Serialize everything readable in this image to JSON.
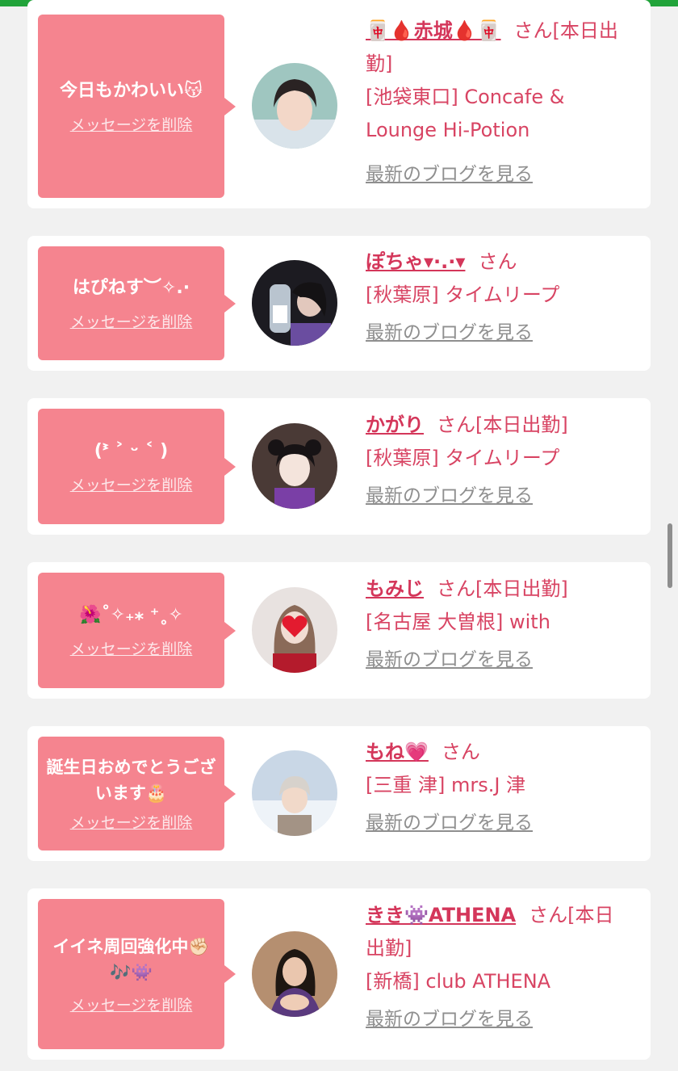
{
  "cards": [
    {
      "message": "今日もかわいい😽",
      "delete_label": "メッセージを削除",
      "name": "🀄🩸赤城🩸🀄",
      "honorific": "さん",
      "status": "[本日出勤]",
      "shop": "[池袋東口] Concafe & Lounge Hi-Potion",
      "blog_link": "最新のブログを見る"
    },
    {
      "message": "はぴねす︶✧.·",
      "delete_label": "メッセージを削除",
      "name": "ぽちゃ▾·.·▾",
      "honorific": "さん",
      "status": "",
      "shop": "[秋葉原] タイムリープ",
      "blog_link": "最新のブログを見る"
    },
    {
      "message": "(ᕑ ˃ ᵕ ˂ )",
      "delete_label": "メッセージを削除",
      "name": "かがり",
      "honorific": "さん",
      "status": "[本日出勤]",
      "shop": "[秋葉原] タイムリープ",
      "blog_link": "最新のブログを見る"
    },
    {
      "message": "🌺˚✧₊⁎ ⁺˳✧",
      "delete_label": "メッセージを削除",
      "name": "もみじ",
      "honorific": "さん",
      "status": "[本日出勤]",
      "shop": "[名古屋 大曽根] with",
      "blog_link": "最新のブログを見る"
    },
    {
      "message": "誕生日おめでとうございます🎂",
      "delete_label": "メッセージを削除",
      "name": "もね💗",
      "honorific": "さん",
      "status": "",
      "shop": "[三重 津] mrs.J 津",
      "blog_link": "最新のブログを見る"
    },
    {
      "message": "イイネ周回強化中✊🏻🎶👾",
      "delete_label": "メッセージを削除",
      "name": "きき👾ATHENA",
      "honorific": "さん",
      "status": "[本日出勤]",
      "shop": "[新橋] club ATHENA",
      "blog_link": "最新のブログを見る"
    }
  ],
  "colors": {
    "topbar": "#21a33a",
    "bubble": "#f5848f",
    "name": "#d4365a",
    "link": "#8f8f8f"
  }
}
